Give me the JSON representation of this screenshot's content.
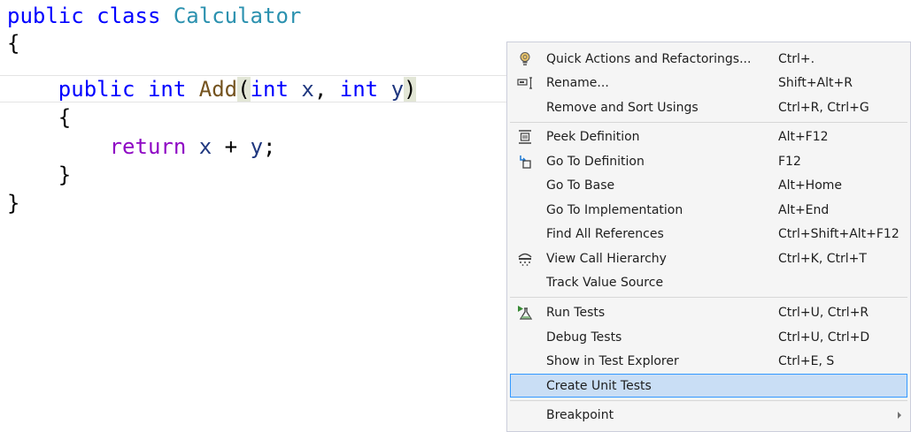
{
  "editor": {
    "line1": {
      "kw_public": "public",
      "kw_class": "class",
      "class_name": "Calculator"
    },
    "line2": {
      "open_brace": "{"
    },
    "line3": {
      "kw_public": "public",
      "kw_int": "int",
      "method_name": "Add",
      "open_paren": "(",
      "param1_type": "int",
      "param1_name": "x",
      "comma": ",",
      "param2_type": "int",
      "param2_name": "y",
      "close_paren": ")"
    },
    "line4": {
      "open_brace": "{"
    },
    "line5": {
      "kw_return": "return",
      "var_x": "x",
      "plus": "+",
      "var_y": "y",
      "semicolon": ";"
    },
    "line6": {
      "close_brace": "}"
    },
    "line7": {
      "close_brace": "}"
    }
  },
  "context_menu": {
    "items": [
      {
        "label": "Quick Actions and Refactorings...",
        "shortcut": "Ctrl+.",
        "icon": "lightbulb-icon"
      },
      {
        "label": "Rename...",
        "shortcut": "Shift+Alt+R",
        "icon": "rename-icon"
      },
      {
        "label": "Remove and Sort Usings",
        "shortcut": "Ctrl+R, Ctrl+G",
        "icon": ""
      },
      {
        "label": "Peek Definition",
        "shortcut": "Alt+F12",
        "icon": "peek-definition-icon"
      },
      {
        "label": "Go To Definition",
        "shortcut": "F12",
        "icon": "go-to-definition-icon"
      },
      {
        "label": "Go To Base",
        "shortcut": "Alt+Home",
        "icon": ""
      },
      {
        "label": "Go To Implementation",
        "shortcut": "Alt+End",
        "icon": ""
      },
      {
        "label": "Find All References",
        "shortcut": "Ctrl+Shift+Alt+F12",
        "icon": ""
      },
      {
        "label": "View Call Hierarchy",
        "shortcut": "Ctrl+K, Ctrl+T",
        "icon": "call-hierarchy-icon"
      },
      {
        "label": "Track Value Source",
        "shortcut": "",
        "icon": ""
      },
      {
        "label": "Run Tests",
        "shortcut": "Ctrl+U, Ctrl+R",
        "icon": "run-tests-icon"
      },
      {
        "label": "Debug Tests",
        "shortcut": "Ctrl+U, Ctrl+D",
        "icon": ""
      },
      {
        "label": "Show in Test Explorer",
        "shortcut": "Ctrl+E, S",
        "icon": ""
      },
      {
        "label": "Create Unit Tests",
        "shortcut": "",
        "icon": "",
        "selected": true
      },
      {
        "label": "Breakpoint",
        "shortcut": "",
        "icon": "",
        "submenu": true
      }
    ]
  },
  "colors": {
    "keyword": "#0000ff",
    "type_name": "#2b91af",
    "method_name": "#74531f",
    "control_keyword": "#8f08c4",
    "parameter": "#1f377f",
    "menu_background": "#f5f5f5",
    "menu_selected_background": "#c9def5",
    "menu_selected_border": "#3399ff"
  }
}
